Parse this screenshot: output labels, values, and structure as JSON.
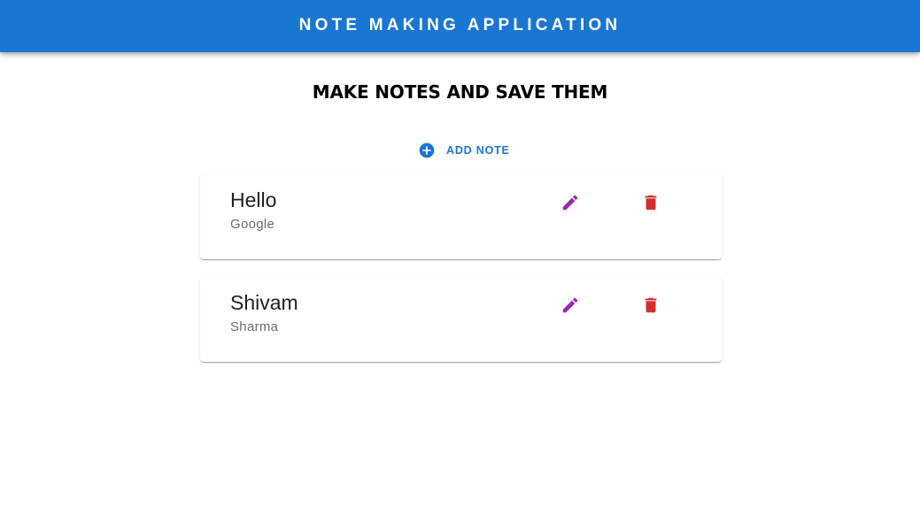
{
  "appbar": {
    "title": "NOTE MAKING APPLICATION",
    "color": "#1976d2"
  },
  "main": {
    "heading": "MAKE NOTES AND SAVE THEM",
    "add_button": {
      "label": "ADD NOTE",
      "icon": "add-circle-icon"
    }
  },
  "notes": [
    {
      "title": "Hello",
      "content": "Google",
      "edit_icon": "pencil-icon",
      "delete_icon": "trash-icon"
    },
    {
      "title": "Shivam",
      "content": "Sharma",
      "edit_icon": "pencil-icon",
      "delete_icon": "trash-icon"
    }
  ],
  "colors": {
    "primary": "#1976d2",
    "edit": "#9c27b0",
    "delete": "#d32f2f"
  }
}
